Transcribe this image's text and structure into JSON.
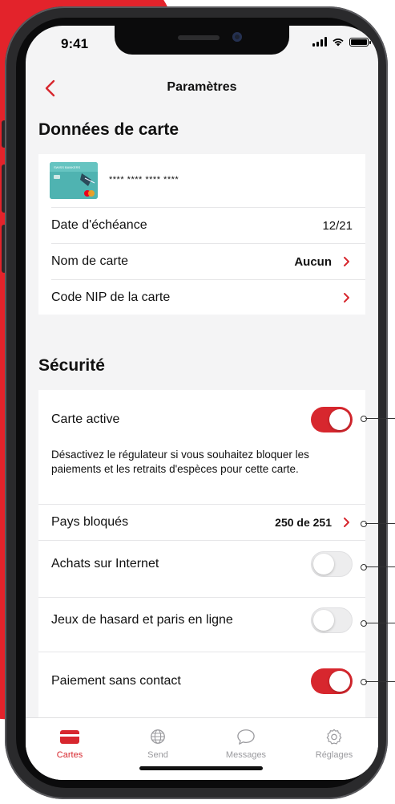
{
  "status_bar": {
    "time": "9:41"
  },
  "nav": {
    "title": "Paramètres"
  },
  "card_data_section": {
    "title": "Données de carte",
    "card_number": "**** **** **** ****",
    "card_thumb_text": "SWISS BANKERS",
    "rows": [
      {
        "label": "Date d'échéance",
        "value": "12/21"
      },
      {
        "label": "Nom de carte",
        "value": "Aucun"
      },
      {
        "label": "Code NIP de la carte",
        "value": ""
      }
    ]
  },
  "security_section": {
    "title": "Sécurité",
    "card_active": {
      "label": "Carte active",
      "on": true
    },
    "description": "Désactivez le régulateur si vous souhaitez bloquer les paiements et les retraits d'espèces pour cette carte.",
    "blocked_countries": {
      "label": "Pays bloqués",
      "value": "250 de 251"
    },
    "internet_purchases": {
      "label": "Achats sur Internet",
      "on": false
    },
    "gambling": {
      "label": "Jeux de hasard et paris en ligne",
      "on": false
    },
    "contactless": {
      "label": "Paiement sans contact",
      "on": true
    }
  },
  "tabbar": {
    "tabs": [
      {
        "label": "Cartes",
        "icon": "card-icon",
        "active": true
      },
      {
        "label": "Send",
        "icon": "globe-icon",
        "active": false
      },
      {
        "label": "Messages",
        "icon": "chat-bubble-icon",
        "active": false
      },
      {
        "label": "Réglages",
        "icon": "gear-icon",
        "active": false
      }
    ]
  },
  "colors": {
    "accent": "#d7272e",
    "background_red": "#e3232b",
    "screen_bg": "#f4f4f5"
  }
}
